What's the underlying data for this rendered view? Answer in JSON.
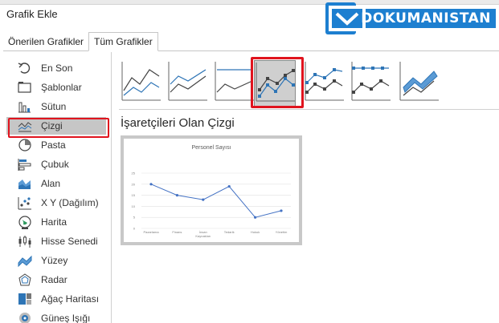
{
  "dialog": {
    "title": "Grafik Ekle"
  },
  "logo": {
    "text": "DOKUMANISTAN"
  },
  "tabs": [
    {
      "label": "Önerilen Grafikler",
      "active": false
    },
    {
      "label": "Tüm Grafikler",
      "active": true
    }
  ],
  "sidebar": {
    "items": [
      {
        "label": "En Son",
        "icon": "undo-icon",
        "selected": false
      },
      {
        "label": "Şablonlar",
        "icon": "folder-icon",
        "selected": false
      },
      {
        "label": "Sütun",
        "icon": "column-chart-icon",
        "selected": false
      },
      {
        "label": "Çizgi",
        "icon": "line-chart-icon",
        "selected": true
      },
      {
        "label": "Pasta",
        "icon": "pie-chart-icon",
        "selected": false
      },
      {
        "label": "Çubuk",
        "icon": "bar-chart-icon",
        "selected": false
      },
      {
        "label": "Alan",
        "icon": "area-chart-icon",
        "selected": false
      },
      {
        "label": "X Y (Dağılım)",
        "icon": "scatter-chart-icon",
        "selected": false
      },
      {
        "label": "Harita",
        "icon": "globe-icon",
        "selected": false
      },
      {
        "label": "Hisse Senedi",
        "icon": "stock-chart-icon",
        "selected": false
      },
      {
        "label": "Yüzey",
        "icon": "surface-chart-icon",
        "selected": false
      },
      {
        "label": "Radar",
        "icon": "radar-chart-icon",
        "selected": false
      },
      {
        "label": "Ağaç Haritası",
        "icon": "treemap-icon",
        "selected": false
      },
      {
        "label": "Güneş Işığı",
        "icon": "sunburst-icon",
        "selected": false
      }
    ]
  },
  "chart_types": [
    {
      "icon": "line-icon",
      "selected": false
    },
    {
      "icon": "stacked-line-icon",
      "selected": false
    },
    {
      "icon": "100-stacked-line-icon",
      "selected": false
    },
    {
      "icon": "line-with-markers-icon",
      "selected": true
    },
    {
      "icon": "stacked-line-with-markers-icon",
      "selected": false
    },
    {
      "icon": "100-stacked-line-with-markers-icon",
      "selected": false
    },
    {
      "icon": "3d-line-icon",
      "selected": false
    }
  ],
  "selected_type_label": "İşaretçileri Olan Çizgi",
  "colors": {
    "accent_red": "#e0141e",
    "series_blue": "#4472c4",
    "logo_blue": "#1d7fd0",
    "selected_gray": "#c6c6c6"
  },
  "chart_data": {
    "type": "line",
    "title": "Personel Sayısı",
    "categories": [
      "Pazarlama",
      "Finans",
      "İnsan Kaynakları",
      "Tedarik",
      "Hukuk",
      "Yönetim"
    ],
    "values": [
      20,
      15,
      13,
      19,
      5,
      8
    ],
    "ylim": [
      0,
      25
    ],
    "yticks": [
      "0",
      "5",
      "10",
      "15",
      "20",
      "25"
    ],
    "markers": true,
    "grid": true,
    "legend": "none"
  }
}
